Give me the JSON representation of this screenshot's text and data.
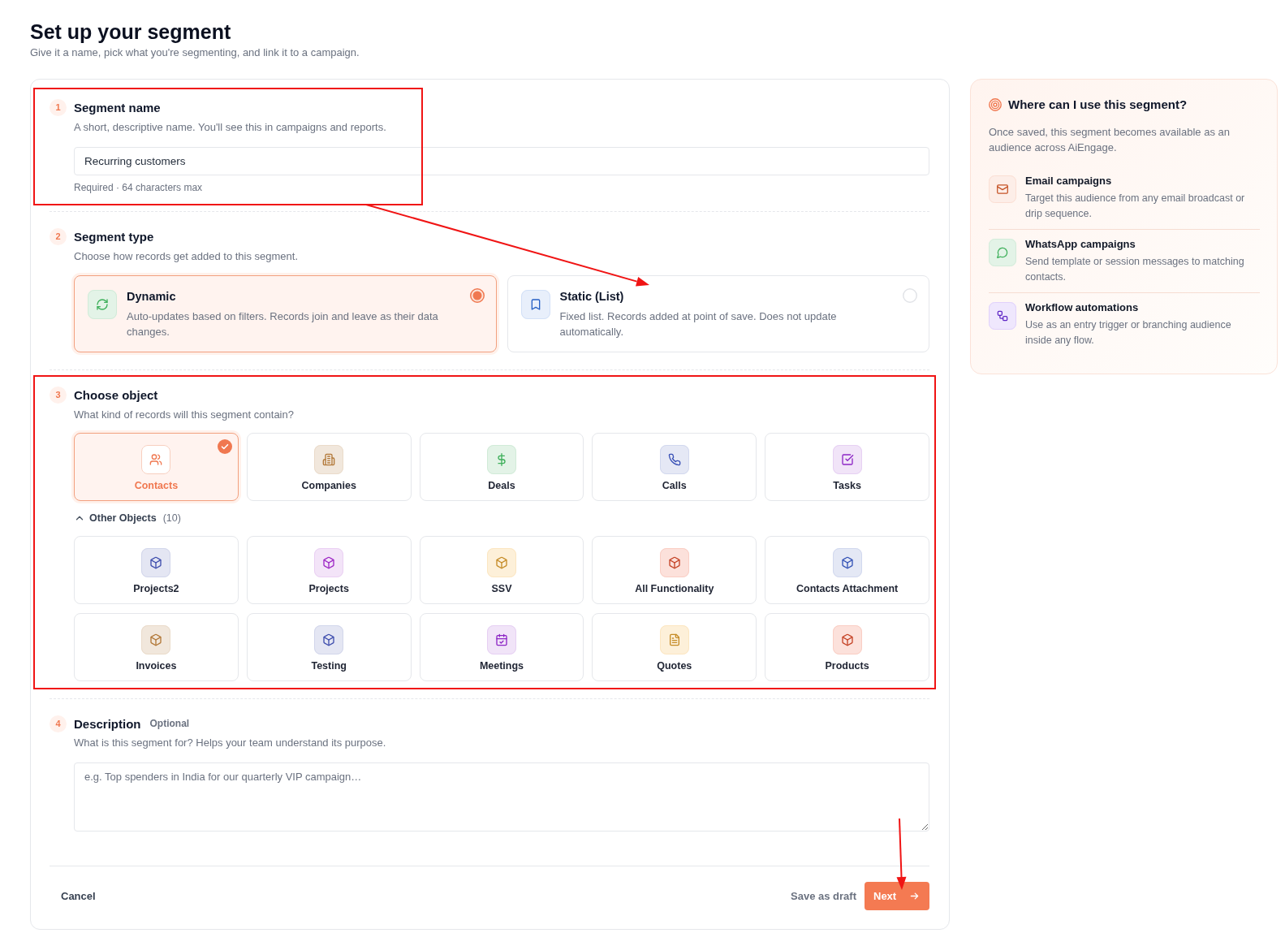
{
  "page": {
    "title": "Set up your segment",
    "subtitle": "Give it a name, pick what you're segmenting, and link it to a campaign."
  },
  "sections": [
    {
      "kind": "name",
      "number": "1",
      "title": "Segment name",
      "description": "A short, descriptive name. You'll see this in campaigns and reports.",
      "field": {
        "value": "Recurring customers"
      },
      "hint": "Required · 64 characters max"
    },
    {
      "kind": "type",
      "number": "2",
      "title": "Segment type",
      "description": "Choose how records get added to this segment.",
      "options": [
        {
          "kind": "dynamic",
          "title": "Dynamic",
          "description": "Auto-updates based on filters. Records join and leave as their data changes.",
          "color": "#e3f3e7",
          "selected": true
        },
        {
          "kind": "static",
          "title": "Static (List)",
          "description": "Fixed list. Records added at point of save. Does not update automatically.",
          "color": "#e8effb",
          "selected": false
        }
      ]
    },
    {
      "kind": "objects",
      "number": "3",
      "title": "Choose object",
      "description": "What kind of records will this segment contain?",
      "objects": [
        {
          "kind": "person",
          "label": "Contacts",
          "color": "#ffffff",
          "selected": true
        },
        {
          "kind": "company",
          "label": "Companies",
          "color": "#f1e7dc",
          "selected": false
        },
        {
          "kind": "deal",
          "label": "Deals",
          "color": "#e3f3e7",
          "selected": false
        },
        {
          "kind": "call",
          "label": "Calls",
          "color": "#e5e8f5",
          "selected": false
        },
        {
          "kind": "task",
          "label": "Tasks",
          "color": "#f1e4f8",
          "selected": false
        }
      ],
      "other_objects": {
        "label": "Other Objects",
        "count": "(10)",
        "expanded": true,
        "objects": [
          {
            "kind": "custom",
            "label": "Projects2",
            "color": "#e4e6f3",
            "selected": false
          },
          {
            "kind": "custom",
            "label": "Projects",
            "color": "#f3e4f8",
            "selected": false
          },
          {
            "kind": "custom",
            "label": "SSV",
            "color": "#fdf0d9",
            "selected": false
          },
          {
            "kind": "custom",
            "label": "All Functionality",
            "color": "#fce1db",
            "selected": false
          },
          {
            "kind": "custom",
            "label": "Contacts Attachment",
            "color": "#e4e8f5",
            "selected": false
          },
          {
            "kind": "custom",
            "label": "Invoices",
            "color": "#f1e7dc",
            "selected": false
          },
          {
            "kind": "custom",
            "label": "Testing",
            "color": "#e4e6f3",
            "selected": false
          },
          {
            "kind": "meeting",
            "label": "Meetings",
            "color": "#f1e4f8",
            "selected": false
          },
          {
            "kind": "quote",
            "label": "Quotes",
            "color": "#fdf0d9",
            "selected": false
          },
          {
            "kind": "custom",
            "label": "Products",
            "color": "#fce1db",
            "selected": false
          }
        ]
      }
    },
    {
      "kind": "description",
      "number": "4",
      "title": "Description",
      "tag": "Optional",
      "description": "What is this segment for? Helps your team understand its purpose.",
      "field": {
        "placeholder": "e.g. Top spenders in India for our quarterly VIP campaign…"
      }
    }
  ],
  "footer": {
    "cancel": "Cancel",
    "save_draft": "Save as draft",
    "next": "Next"
  },
  "side_panel": {
    "title": "Where can I use this segment?",
    "description": "Once saved, this segment becomes available as an audience across AiEngage.",
    "items": [
      {
        "kind": "email",
        "title": "Email campaigns",
        "description": "Target this audience from any email broadcast or drip sequence.",
        "color": "#fdeee8"
      },
      {
        "kind": "chat",
        "title": "WhatsApp campaigns",
        "description": "Send template or session messages to matching contacts.",
        "color": "#e3f3e7"
      },
      {
        "kind": "workflow",
        "title": "Workflow automations",
        "description": "Use as an entry trigger or branching audience inside any flow.",
        "color": "#efe7fd"
      }
    ]
  },
  "annotations": [
    {
      "kind": "box"
    },
    {
      "kind": "arrow"
    },
    {
      "kind": "box"
    },
    {
      "kind": "arrow"
    }
  ]
}
